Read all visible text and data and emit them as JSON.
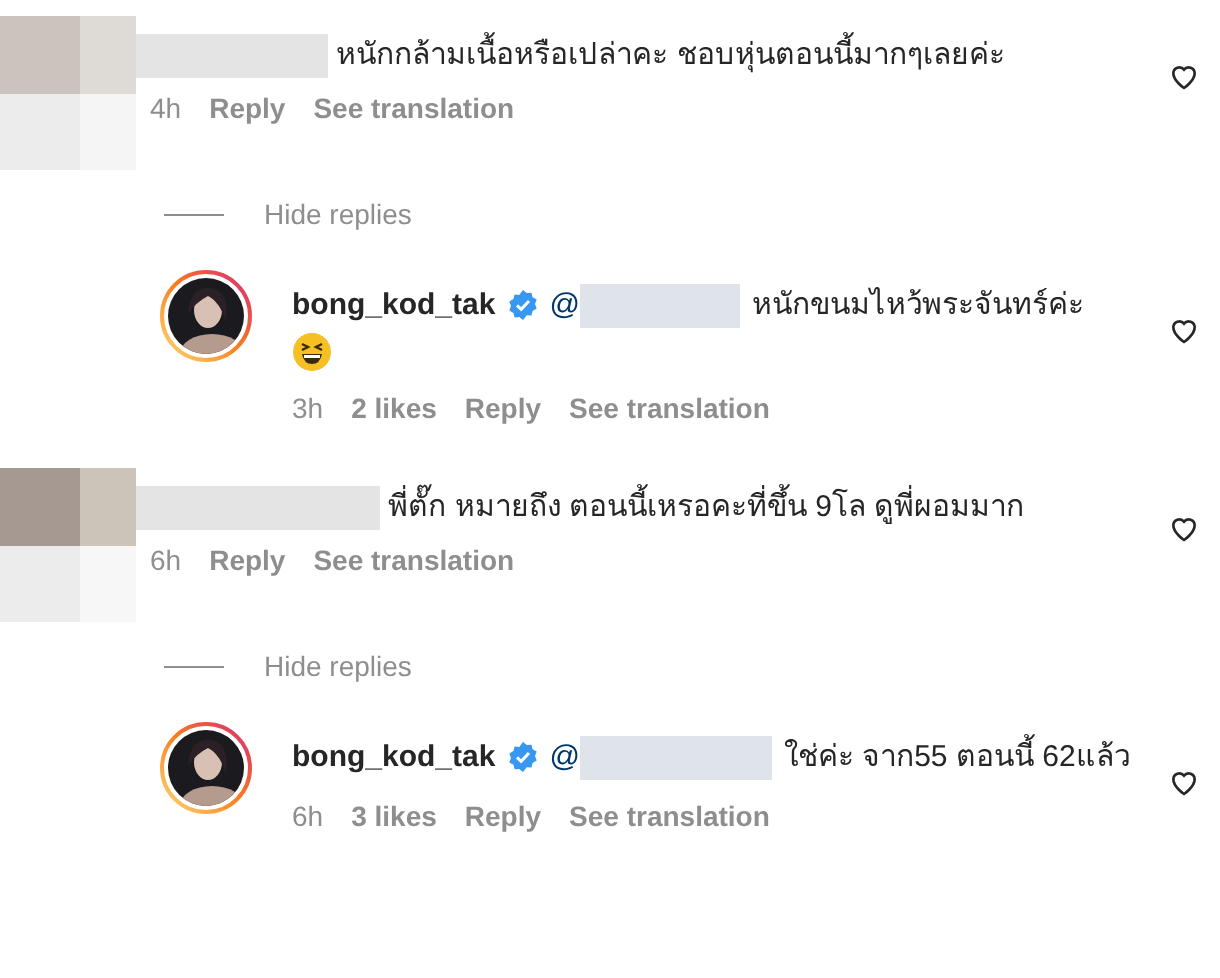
{
  "comments": [
    {
      "text": "หนักกล้ามเนื้อหรือเปล่าคะ ชอบหุ่นตอนนี้มากๆเลยค่ะ",
      "time": "4h",
      "reply_label": "Reply",
      "translate_label": "See translation",
      "liked": false,
      "hide_replies_label": "Hide replies",
      "replies": [
        {
          "username": "bong_kod_tak",
          "verified": true,
          "mention_prefix": "@",
          "text": "หนักขนมไหว้พระจันทร์ค่ะ",
          "emoji": true,
          "time": "3h",
          "likes": "2 likes",
          "reply_label": "Reply",
          "translate_label": "See translation",
          "liked": false
        }
      ]
    },
    {
      "text": "พี่ตั๊ก หมายถึง ตอนนี้เหรอคะที่ขึ้น 9โล ดูพี่ผอมมาก",
      "time": "6h",
      "reply_label": "Reply",
      "translate_label": "See translation",
      "liked": false,
      "hide_replies_label": "Hide replies",
      "replies": [
        {
          "username": "bong_kod_tak",
          "verified": true,
          "mention_prefix": "@",
          "text": "ใช่ค่ะ จาก55 ตอนนี้ 62แล้ว",
          "emoji": false,
          "time": "6h",
          "likes": "3 likes",
          "reply_label": "Reply",
          "translate_label": "See translation",
          "liked": false
        }
      ]
    }
  ]
}
